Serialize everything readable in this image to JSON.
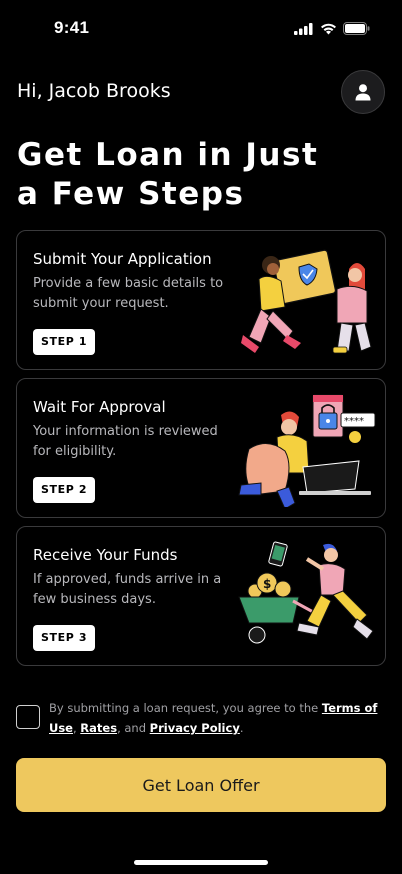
{
  "status_bar": {
    "time": "9:41"
  },
  "header": {
    "greeting_prefix": "Hi,",
    "user_name": "Jacob Brooks",
    "avatar_icon": "user-icon"
  },
  "page_title_line1": "Get Loan in Just",
  "page_title_line2": "a Few Steps",
  "steps": [
    {
      "title": "Submit Your Application",
      "description": "Provide a few basic details to submit your request.",
      "badge": "STEP 1",
      "illustration": "people-exchanging-shield-folder"
    },
    {
      "title": "Wait For Approval",
      "description": "Your information is reviewed for eligibility.",
      "badge": "STEP 2",
      "illustration": "person-with-laptop-and-lock"
    },
    {
      "title": "Receive Your Funds",
      "description": "If approved, funds arrive in a few business days.",
      "badge": "STEP 3",
      "illustration": "person-with-wheelbarrow-of-coins"
    }
  ],
  "consent": {
    "prefix": "By submitting a loan request, you agree to the ",
    "terms_link": "Terms of Use",
    "separator1": ", ",
    "rates_link": "Rates",
    "separator2": ", and ",
    "privacy_link": "Privacy Policy",
    "suffix": "."
  },
  "cta": {
    "label": "Get Loan Offer",
    "color": "#eec85e"
  },
  "colors": {
    "background": "#000000",
    "card_border": "#3a3a3c",
    "accent": "#eec85e"
  }
}
